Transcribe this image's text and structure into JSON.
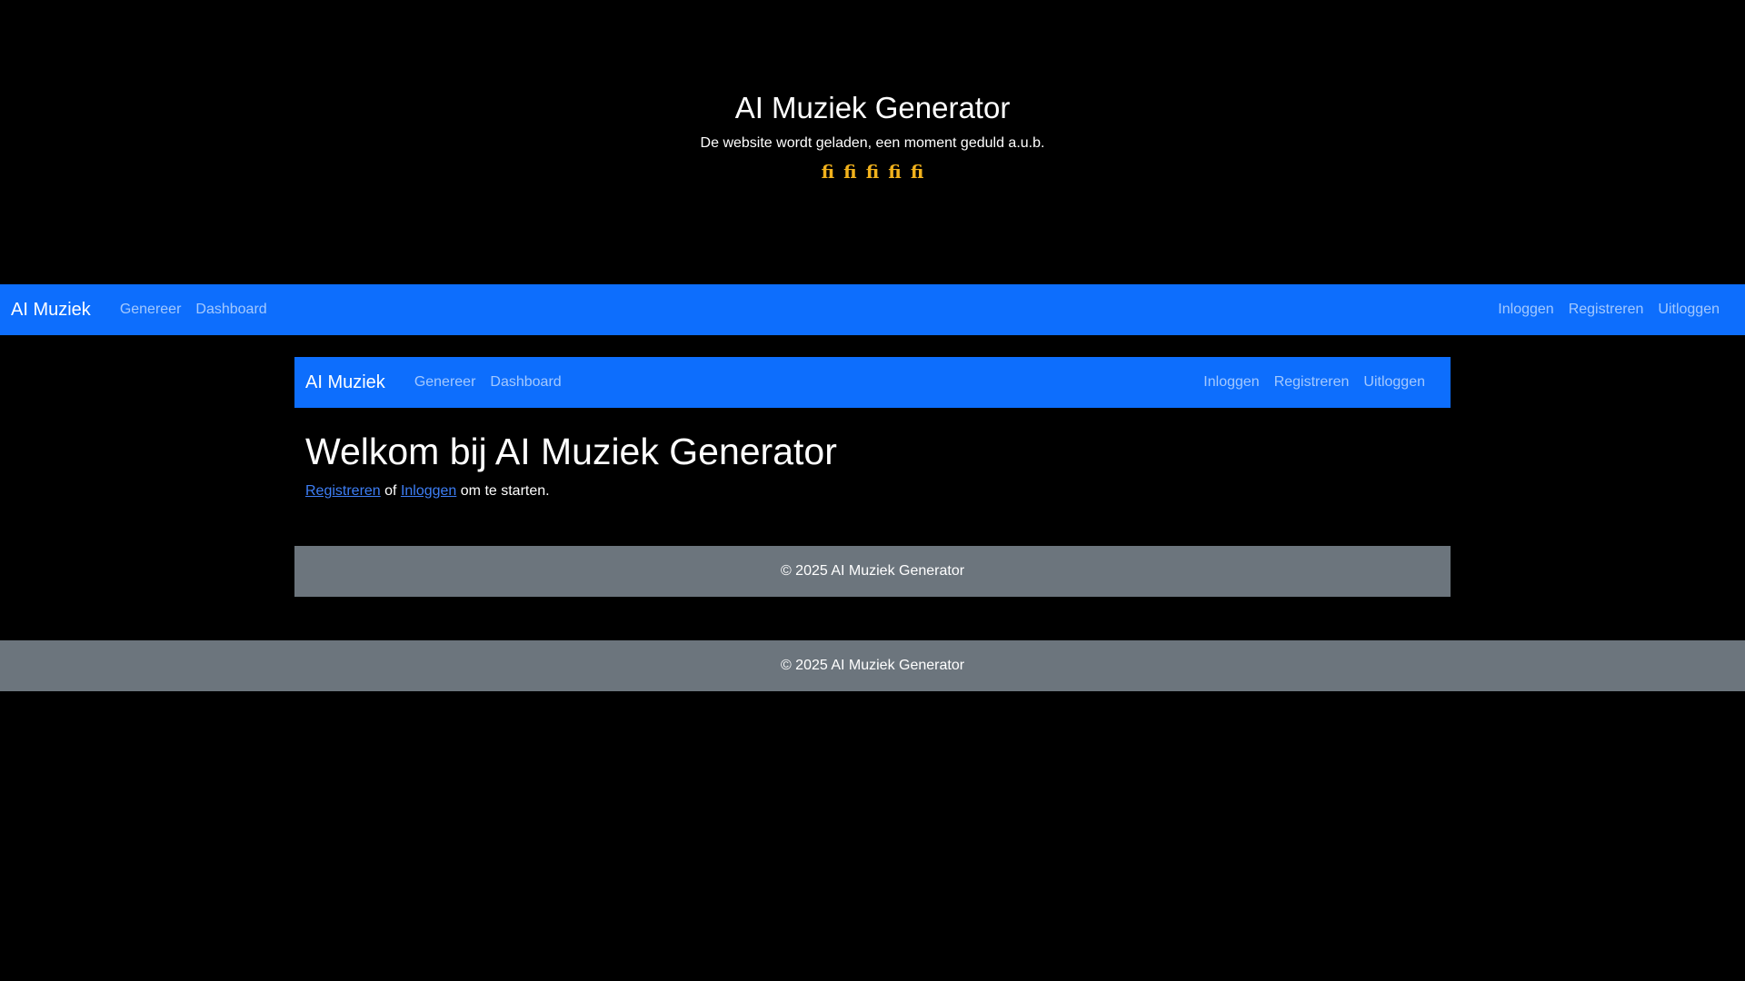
{
  "loader": {
    "title": "AI Muziek Generator",
    "subtitle": "De website wordt geladen, een moment geduld a.u.b.",
    "notes": [
      "ﬁ",
      "ﬁ",
      "ﬁ",
      "ﬁ",
      "ﬁ"
    ],
    "note_color": "#f2b21c"
  },
  "navbar": {
    "brand": "AI Muziek",
    "left_links": [
      "Genereer",
      "Dashboard"
    ],
    "right_links": [
      "Inloggen",
      "Registreren",
      "Uitloggen"
    ],
    "background": "#0d6efd"
  },
  "main": {
    "title": "Welkom bij AI Muziek Generator",
    "register_link": "Registreren",
    "or_text": " of ",
    "login_link": "Inloggen",
    "suffix_text": " om te starten."
  },
  "footer": {
    "text": "© 2025 AI Muziek Generator",
    "background": "#6c757d"
  }
}
